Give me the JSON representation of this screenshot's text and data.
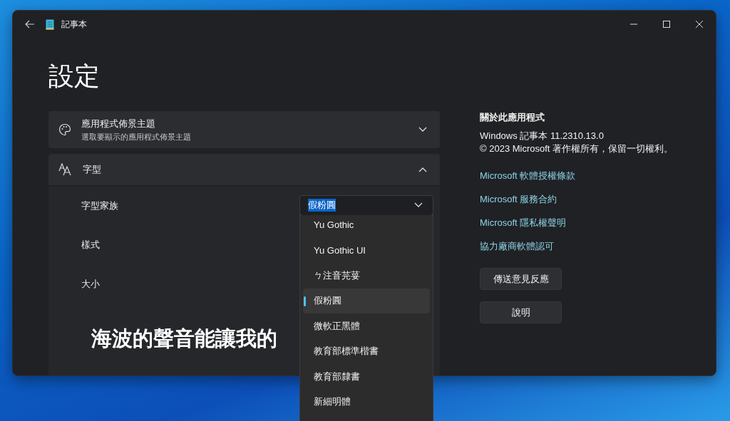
{
  "window": {
    "title": "記事本"
  },
  "page_title": "設定",
  "theme_card": {
    "title": "應用程式佈景主題",
    "subtitle": "選取要顯示的應用程式佈景主題",
    "expanded": false
  },
  "font_card": {
    "title": "字型",
    "expanded": true,
    "rows": [
      {
        "label": "字型家族"
      },
      {
        "label": "樣式"
      },
      {
        "label": "大小"
      }
    ],
    "font_family": {
      "value": "假粉圓"
    },
    "preview": "海波的聲音能讓我的"
  },
  "font_list": [
    {
      "label": "Yu Gothic",
      "selected": false
    },
    {
      "label": "Yu Gothic UI",
      "selected": false
    },
    {
      "label": "ㄅ注音芫荽",
      "selected": false
    },
    {
      "label": "假粉圓",
      "selected": true
    },
    {
      "label": "微軟正黑體",
      "selected": false
    },
    {
      "label": "教育部標準楷書",
      "selected": false
    },
    {
      "label": "教育部隸書",
      "selected": false
    },
    {
      "label": "新細明體",
      "selected": false
    }
  ],
  "about": {
    "heading": "關於此應用程式",
    "version": "Windows 記事本 11.2310.13.0",
    "copyright": "© 2023 Microsoft 著作權所有，保留一切權利。",
    "links": [
      "Microsoft 軟體授權條款",
      "Microsoft 服務合約",
      "Microsoft 隱私權聲明",
      "協力廠商軟體認可"
    ],
    "buttons": [
      "傳送意見反應",
      "說明"
    ]
  }
}
